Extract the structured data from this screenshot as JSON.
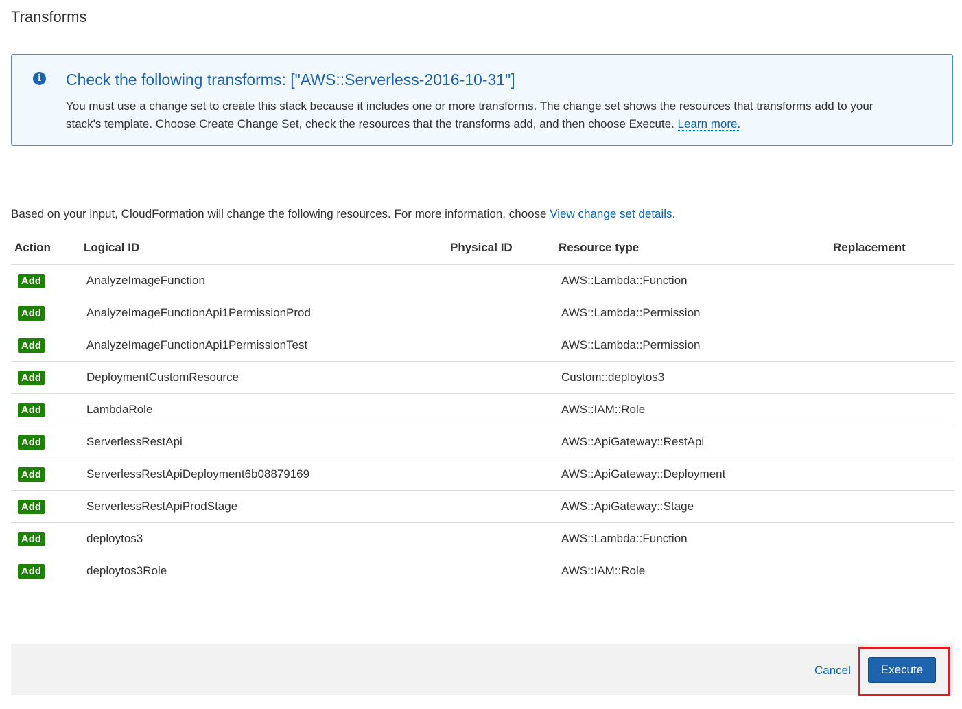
{
  "section": {
    "title": "Transforms"
  },
  "info": {
    "icon": "info-icon",
    "icon_glyph": "i",
    "heading": "Check the following transforms: [\"AWS::Serverless-2016-10-31\"]",
    "body_line1": "You must use a change set to create this stack because it includes one or more transforms. The change set shows the resources that transforms add to your",
    "body_line2": "stack's template. Choose Create Change Set, check the resources that the transforms add, and then choose Execute.",
    "learn_more": "Learn more."
  },
  "intro": {
    "text": "Based on your input, CloudFormation will change the following resources. For more information, choose",
    "link": "View change set details."
  },
  "table": {
    "headers": {
      "action": "Action",
      "logical_id": "Logical ID",
      "physical_id": "Physical ID",
      "resource_type": "Resource type",
      "replacement": "Replacement"
    },
    "rows": [
      {
        "action": "Add",
        "logical_id": "AnalyzeImageFunction",
        "physical_id": "",
        "resource_type": "AWS::Lambda::Function",
        "replacement": ""
      },
      {
        "action": "Add",
        "logical_id": "AnalyzeImageFunctionApi1PermissionProd",
        "physical_id": "",
        "resource_type": "AWS::Lambda::Permission",
        "replacement": ""
      },
      {
        "action": "Add",
        "logical_id": "AnalyzeImageFunctionApi1PermissionTest",
        "physical_id": "",
        "resource_type": "AWS::Lambda::Permission",
        "replacement": ""
      },
      {
        "action": "Add",
        "logical_id": "DeploymentCustomResource",
        "physical_id": "",
        "resource_type": "Custom::deploytos3",
        "replacement": ""
      },
      {
        "action": "Add",
        "logical_id": "LambdaRole",
        "physical_id": "",
        "resource_type": "AWS::IAM::Role",
        "replacement": ""
      },
      {
        "action": "Add",
        "logical_id": "ServerlessRestApi",
        "physical_id": "",
        "resource_type": "AWS::ApiGateway::RestApi",
        "replacement": ""
      },
      {
        "action": "Add",
        "logical_id": "ServerlessRestApiDeployment6b08879169",
        "physical_id": "",
        "resource_type": "AWS::ApiGateway::Deployment",
        "replacement": ""
      },
      {
        "action": "Add",
        "logical_id": "ServerlessRestApiProdStage",
        "physical_id": "",
        "resource_type": "AWS::ApiGateway::Stage",
        "replacement": ""
      },
      {
        "action": "Add",
        "logical_id": "deploytos3",
        "physical_id": "",
        "resource_type": "AWS::Lambda::Function",
        "replacement": ""
      },
      {
        "action": "Add",
        "logical_id": "deploytos3Role",
        "physical_id": "",
        "resource_type": "AWS::IAM::Role",
        "replacement": ""
      }
    ]
  },
  "footer": {
    "cancel_label": "Cancel",
    "execute_label": "Execute"
  },
  "colors": {
    "accent": "#1e63ad",
    "link": "#0066c0",
    "add_badge": "#1d8102",
    "highlight": "#e01b24"
  }
}
